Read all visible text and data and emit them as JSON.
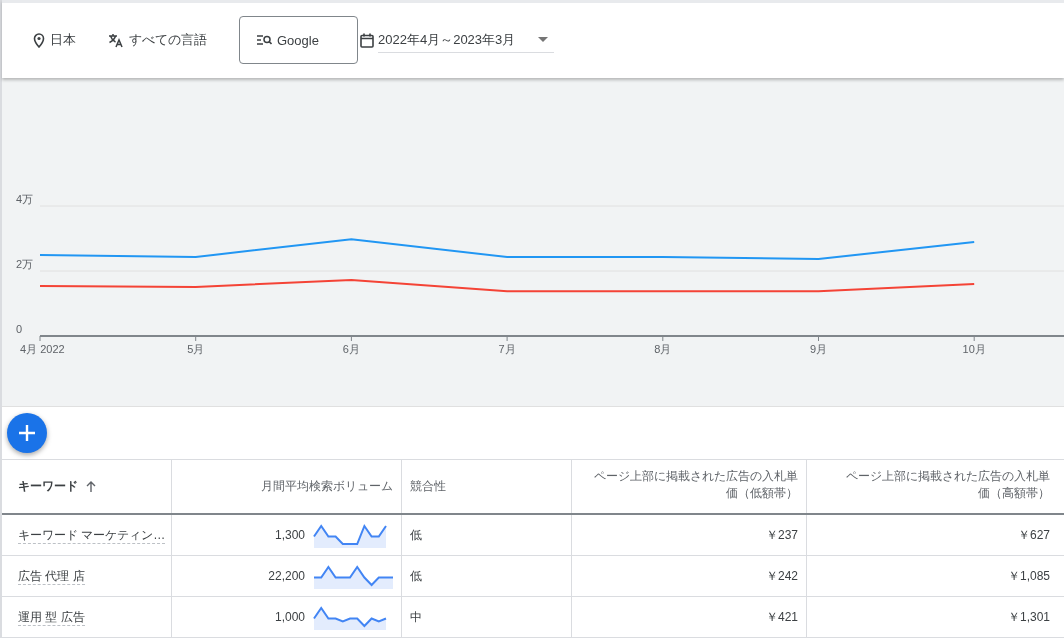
{
  "toolbar": {
    "location": "日本",
    "language": "すべての言語",
    "network": "Google",
    "date_range": "2022年4月～2023年3月"
  },
  "chart": {
    "chart_data": {
      "type": "line",
      "categories": [
        "4月 2022",
        "5月",
        "6月",
        "7月",
        "8月",
        "9月",
        "10月"
      ],
      "ylim": [
        0,
        4
      ],
      "yticks": [
        {
          "value": 0,
          "label": "0"
        },
        {
          "value": 2,
          "label": "2万"
        },
        {
          "value": 4,
          "label": "4万"
        }
      ],
      "series": [
        {
          "color": "#2196f3",
          "values": [
            2.49,
            2.43,
            2.98,
            2.43,
            2.43,
            2.37,
            2.89
          ]
        },
        {
          "color": "#f44336",
          "values": [
            1.54,
            1.51,
            1.72,
            1.38,
            1.38,
            1.38,
            1.6
          ]
        }
      ]
    }
  },
  "table": {
    "columns": [
      "キーワード",
      "月間平均検索ボリューム",
      "競合性",
      "ページ上部に掲載された広告の入札単価（低額帯）",
      "ページ上部に掲載された広告の入札単価（高額帯）"
    ],
    "rows": [
      {
        "keyword": "キーワード マーケティン…",
        "volume": "1,300",
        "competition": "低",
        "bid_low": "￥237",
        "bid_high": "￥627"
      },
      {
        "keyword": "広告 代理 店",
        "volume": "22,200",
        "competition": "低",
        "bid_low": "￥242",
        "bid_high": "￥1,085"
      },
      {
        "keyword": "運用 型 広告",
        "volume": "1,000",
        "competition": "中",
        "bid_low": "￥421",
        "bid_high": "￥1,301"
      }
    ]
  }
}
